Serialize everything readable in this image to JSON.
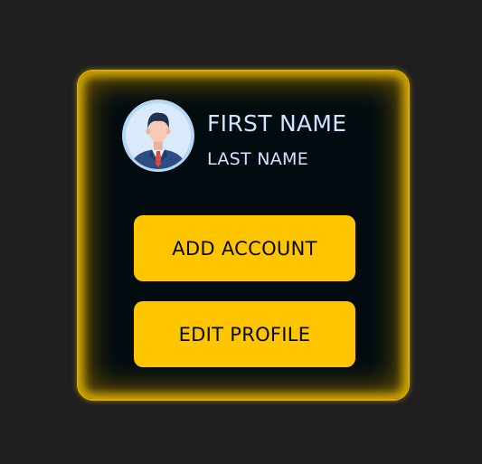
{
  "profile_card": {
    "avatar": {
      "icon": "businessman-avatar-icon",
      "colors": {
        "ring": "#b6d7f5",
        "suit": "#2d4e83",
        "tie": "#dc4a3c",
        "skin": "#f6cbb6",
        "hair": "#1f3252"
      }
    },
    "first_name": "FIRST NAME",
    "last_name": "LAST NAME",
    "buttons": {
      "add_account": "ADD ACCOUNT",
      "edit_profile": "EDIT PROFILE"
    }
  },
  "theme": {
    "page_background": "#1f1f1f",
    "card_background": "#020b10",
    "glow": "#e6b700",
    "button_background": "#ffc600",
    "button_text": "#07090c",
    "name_text": "#cfe4ff"
  }
}
